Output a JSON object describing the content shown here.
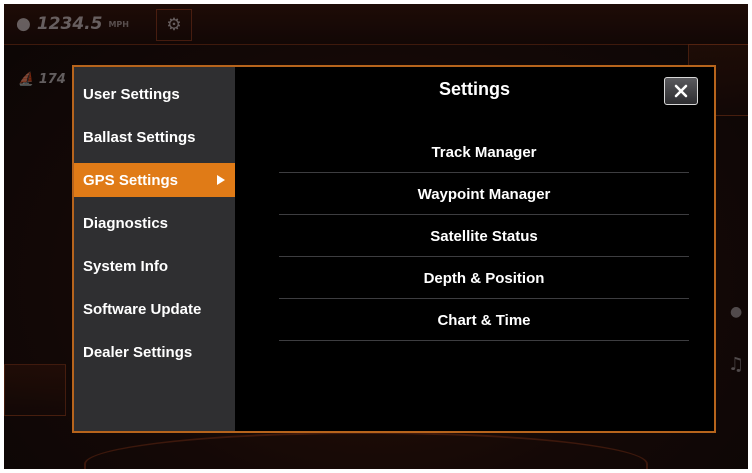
{
  "background": {
    "readout_value": "1234.5",
    "readout_unit": "MPH",
    "readout_secondary": "174",
    "icons": [
      "speed-icon",
      "gear-icon",
      "boat-icon",
      "music-icon"
    ]
  },
  "dialog": {
    "title": "Settings",
    "close_icon": "close-icon",
    "accent_color": "#e07b17",
    "border_color": "#b7641c"
  },
  "sidebar": {
    "items": [
      {
        "label": "User Settings",
        "active": false
      },
      {
        "label": "Ballast Settings",
        "active": false
      },
      {
        "label": "GPS Settings",
        "active": true
      },
      {
        "label": "Diagnostics",
        "active": false
      },
      {
        "label": "System Info",
        "active": false
      },
      {
        "label": "Software Update",
        "active": false
      },
      {
        "label": "Dealer Settings",
        "active": false
      }
    ]
  },
  "menu": {
    "items": [
      {
        "label": "Track Manager"
      },
      {
        "label": "Waypoint Manager"
      },
      {
        "label": "Satellite Status"
      },
      {
        "label": "Depth & Position"
      },
      {
        "label": "Chart & Time"
      }
    ]
  }
}
